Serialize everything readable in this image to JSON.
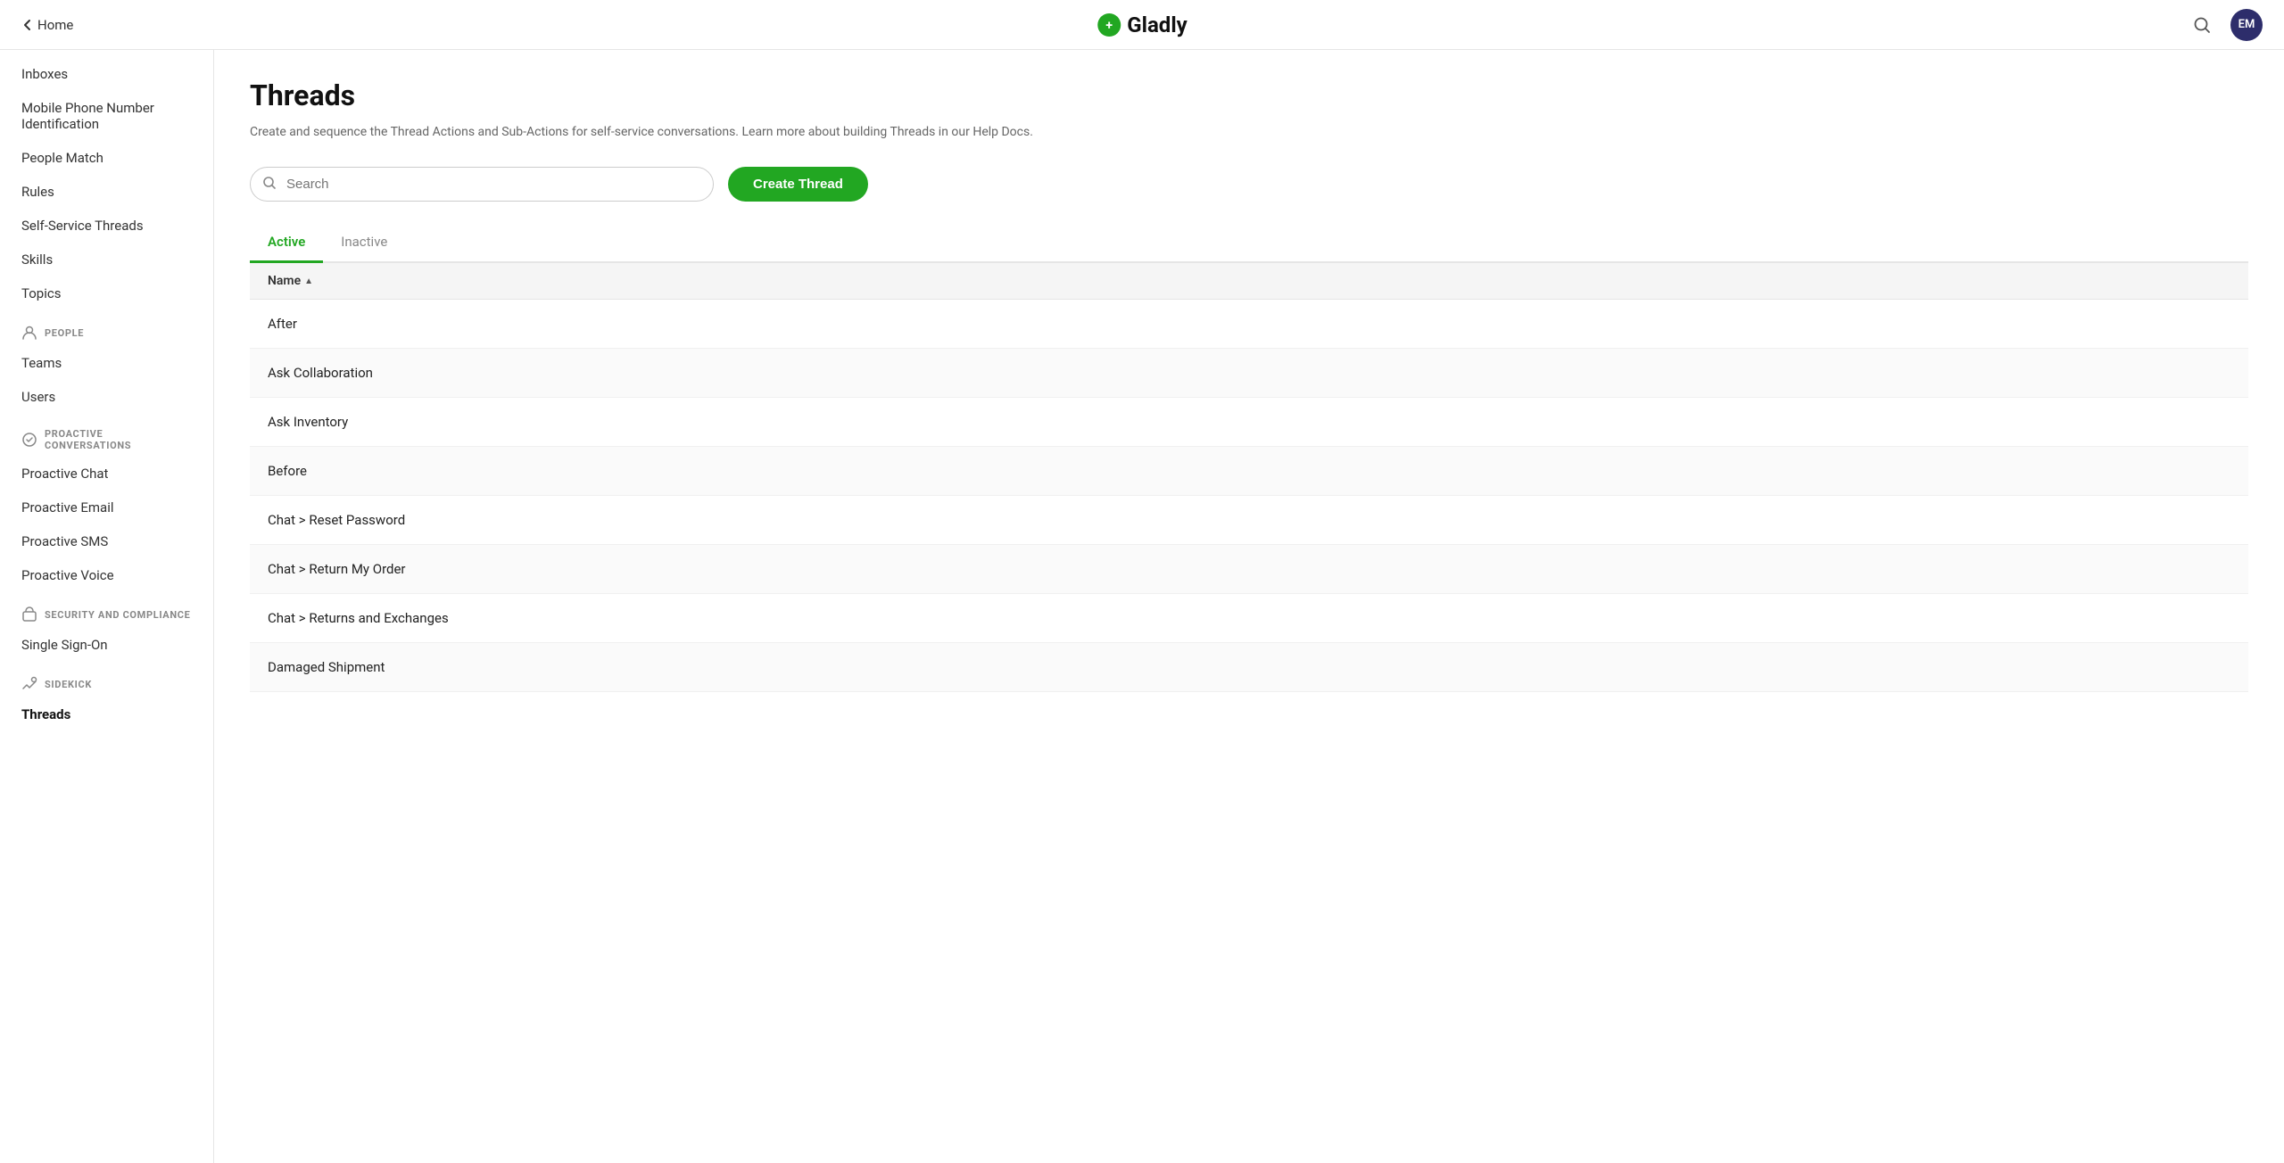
{
  "header": {
    "back_label": "Home",
    "logo_text": "Gladly",
    "avatar_initials": "EM"
  },
  "sidebar": {
    "top_items": [
      {
        "id": "inboxes",
        "label": "Inboxes"
      },
      {
        "id": "mobile-phone",
        "label": "Mobile Phone Number Identification"
      },
      {
        "id": "people-match",
        "label": "People Match"
      },
      {
        "id": "rules",
        "label": "Rules"
      },
      {
        "id": "self-service-threads",
        "label": "Self-Service Threads"
      },
      {
        "id": "skills",
        "label": "Skills"
      },
      {
        "id": "topics",
        "label": "Topics"
      }
    ],
    "sections": [
      {
        "id": "people",
        "label": "PEOPLE",
        "icon": "person",
        "items": [
          {
            "id": "teams",
            "label": "Teams"
          },
          {
            "id": "users",
            "label": "Users"
          }
        ]
      },
      {
        "id": "proactive-conversations",
        "label": "PROACTIVE CONVERSATIONS",
        "icon": "proactive",
        "items": [
          {
            "id": "proactive-chat",
            "label": "Proactive Chat"
          },
          {
            "id": "proactive-email",
            "label": "Proactive Email"
          },
          {
            "id": "proactive-sms",
            "label": "Proactive SMS"
          },
          {
            "id": "proactive-voice",
            "label": "Proactive Voice"
          }
        ]
      },
      {
        "id": "security-compliance",
        "label": "SECURITY AND COMPLIANCE",
        "icon": "security",
        "items": [
          {
            "id": "single-sign-on",
            "label": "Single Sign-On"
          }
        ]
      },
      {
        "id": "sidekick",
        "label": "SIDEKICK",
        "icon": "sidekick",
        "items": [
          {
            "id": "threads",
            "label": "Threads",
            "active": true
          }
        ]
      }
    ]
  },
  "main": {
    "title": "Threads",
    "description": "Create and sequence the Thread Actions and Sub-Actions for self-service conversations. Learn more about building Threads in our Help Docs.",
    "search_placeholder": "Search",
    "create_button_label": "Create Thread",
    "tabs": [
      {
        "id": "active",
        "label": "Active",
        "active": true
      },
      {
        "id": "inactive",
        "label": "Inactive",
        "active": false
      }
    ],
    "table_column_name": "Name",
    "threads": [
      {
        "name": "After"
      },
      {
        "name": "Ask Collaboration"
      },
      {
        "name": "Ask Inventory"
      },
      {
        "name": "Before"
      },
      {
        "name": "Chat > Reset Password"
      },
      {
        "name": "Chat > Return My Order"
      },
      {
        "name": "Chat > Returns and Exchanges"
      },
      {
        "name": "Damaged Shipment"
      }
    ]
  }
}
